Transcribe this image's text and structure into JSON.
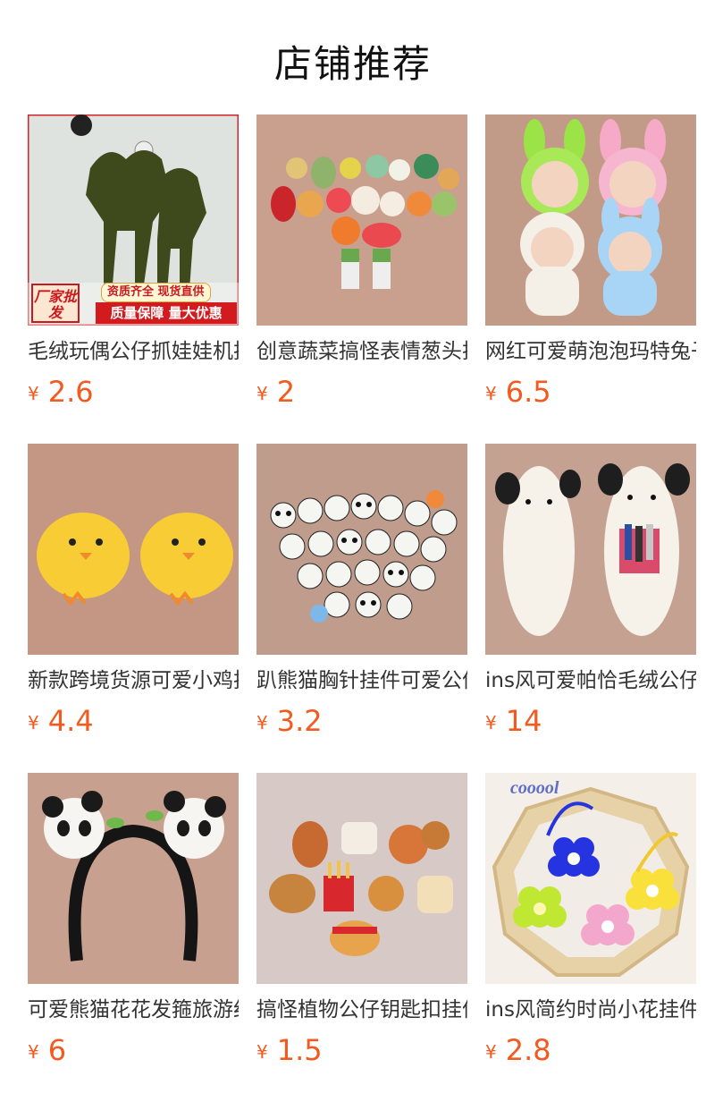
{
  "header": {
    "title": "店铺推荐"
  },
  "currency": "¥",
  "products": [
    {
      "name": "毛绒玩偶公仔抓娃娃机挂件",
      "price": "2.6",
      "badge": {
        "left": "厂家批发",
        "top": "资质齐全 现货直供",
        "bottom": "质量保障 量大优惠"
      }
    },
    {
      "name": "创意蔬菜搞怪表情葱头挂件",
      "price": "2"
    },
    {
      "name": "网红可爱萌泡泡玛特兔子挂件",
      "price": "6.5"
    },
    {
      "name": "新款跨境货源可爱小鸡挂件",
      "price": "4.4"
    },
    {
      "name": "趴熊猫胸针挂件可爱公仔",
      "price": "3.2"
    },
    {
      "name": "ins风可爱帕恰毛绒公仔笔袋",
      "price": "14"
    },
    {
      "name": "可爱熊猫花花发箍旅游纪念",
      "price": "6"
    },
    {
      "name": "搞怪植物公仔钥匙扣挂件",
      "price": "1.5"
    },
    {
      "name": "ins风简约时尚小花挂件",
      "price": "2.8",
      "image_text": "cooool"
    }
  ]
}
